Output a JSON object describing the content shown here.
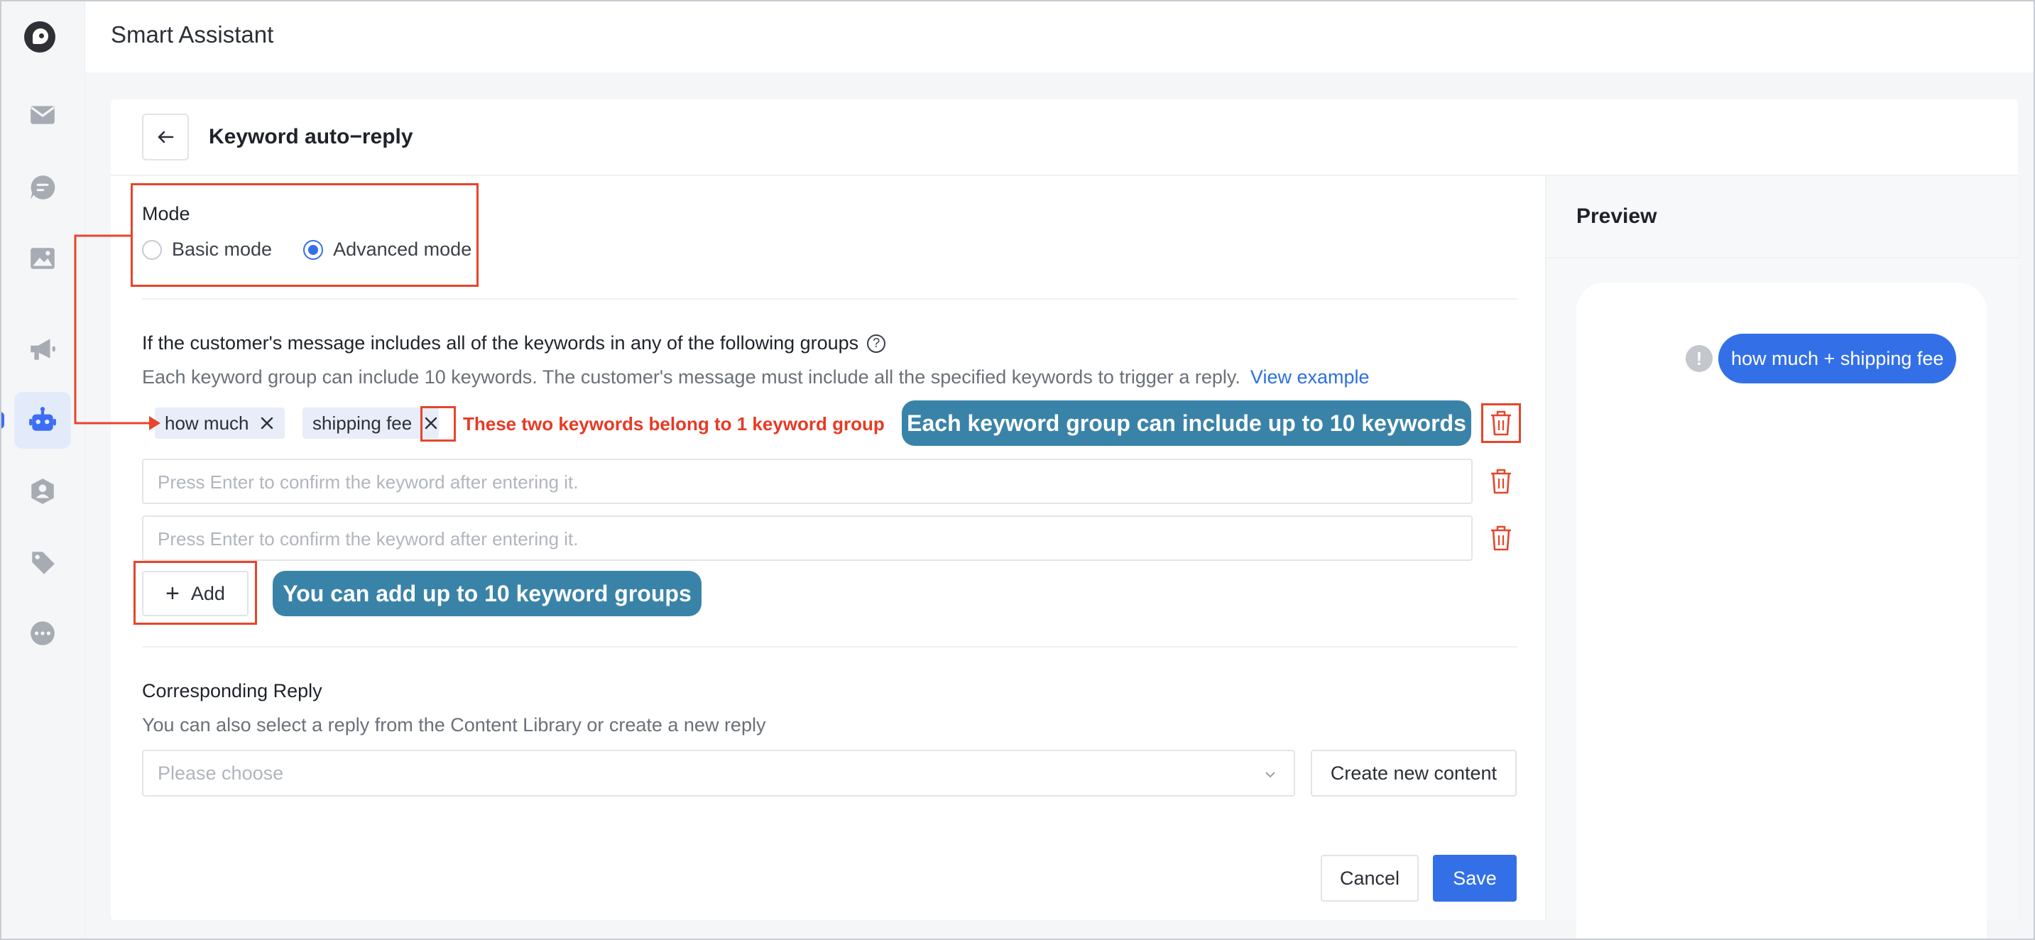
{
  "app": {
    "title": "Smart Assistant"
  },
  "sidebar": {
    "items": [
      {
        "icon": "mail-icon"
      },
      {
        "icon": "chat-icon"
      },
      {
        "icon": "image-icon"
      },
      {
        "icon": "megaphone-icon"
      },
      {
        "icon": "robot-icon",
        "active": true
      },
      {
        "icon": "user-group-icon"
      },
      {
        "icon": "tag-icon"
      },
      {
        "icon": "more-icon"
      }
    ],
    "accent_color": "#3d6df3"
  },
  "page": {
    "title": "Keyword auto−reply"
  },
  "mode": {
    "label": "Mode",
    "options": [
      "Basic mode",
      "Advanced mode"
    ],
    "selected": "Advanced mode"
  },
  "keywords": {
    "title": "If the customer's message includes all of the keywords in any of the following groups",
    "hint": "Each keyword group can include 10 keywords. The customer's message must include all the specified keywords to trigger a reply.",
    "link": "View example",
    "groups": [
      {
        "tags": [
          "how much",
          "shipping fee"
        ]
      },
      {
        "placeholder": "Press Enter to confirm the keyword after entering it."
      },
      {
        "placeholder": "Press Enter to confirm the keyword after entering it."
      }
    ],
    "add_label": "Add"
  },
  "annotations": {
    "group_note": "These two keywords belong to 1 keyword group",
    "keywords_limit": "Each keyword group can include up to 10 keywords",
    "groups_limit": "You can add up to 10 keyword groups"
  },
  "reply": {
    "title": "Corresponding Reply",
    "hint": "You can also select a reply from the Content Library or create a new reply",
    "select_placeholder": "Please choose",
    "create_label": "Create new content"
  },
  "actions": {
    "cancel": "Cancel",
    "save": "Save"
  },
  "preview": {
    "title": "Preview",
    "message": "how much + shipping fee",
    "bubble_color": "#3370e8"
  }
}
